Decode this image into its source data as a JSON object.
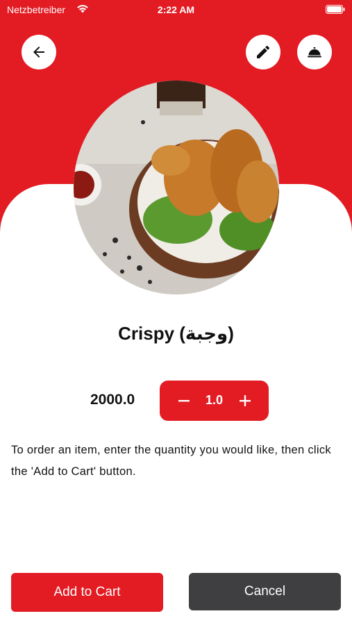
{
  "status_bar": {
    "carrier": "Netzbetreiber",
    "time": "2:22 AM",
    "wifi_icon": "wifi-icon",
    "battery_icon": "battery-icon"
  },
  "header": {
    "back_icon": "arrow-left-icon",
    "edit_icon": "pencil-icon",
    "cloche_icon": "cloche-icon"
  },
  "item": {
    "title": "Crispy (وجبة)",
    "price": "2000.0",
    "quantity": "1.0",
    "image_alt": "fried chicken"
  },
  "instructions": "To order an item, enter the quantity you would like, then click the 'Add to Cart' button.",
  "actions": {
    "add_to_cart": "Add to Cart",
    "cancel": "Cancel"
  },
  "colors": {
    "accent": "#e31b23",
    "cancel": "#3f3f41",
    "background": "#ffffff"
  }
}
